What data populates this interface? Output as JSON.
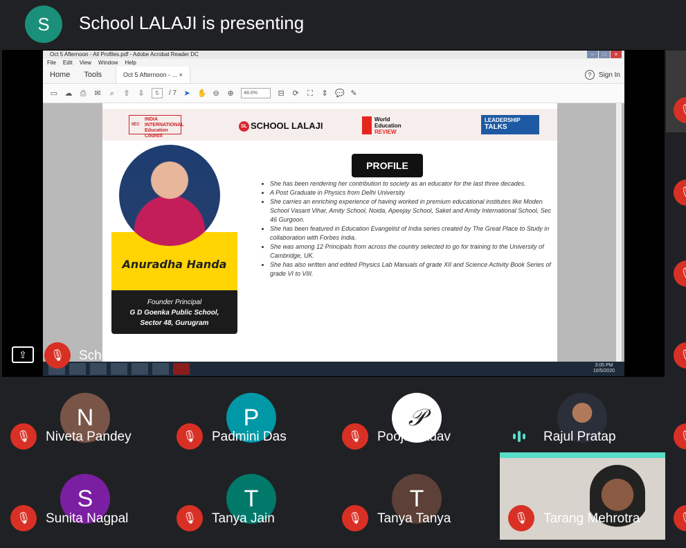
{
  "header": {
    "presenter_initial": "S",
    "title": "School LALAJI is presenting"
  },
  "acrobat": {
    "window_title": "Oct 5 Afternoon - All Profiles.pdf - Adobe Acrobat Reader DC",
    "menu": [
      "File",
      "Edit",
      "View",
      "Window",
      "Help"
    ],
    "tabs": {
      "home": "Home",
      "tools": "Tools",
      "doc": "Oct 5 Afternoon - ...",
      "close": "×"
    },
    "help": "?",
    "sign_in": "Sign In",
    "page_current": "5",
    "page_total": "/ 7",
    "zoom": "48.6%",
    "clock_time": "3:05 PM",
    "clock_date": "10/5/2020"
  },
  "slide": {
    "logos": {
      "iiec": "INDIA INTERNATIONAL Education Council",
      "iiec_badge": "IIEC",
      "school": "SCHOOL LALAJI",
      "school_badge": "SL",
      "wer_line1": "World",
      "wer_line2": "Education",
      "wer_line3": "REVIEW",
      "lt_line1": "LEADERSHIP",
      "lt_line2": "TALKS"
    },
    "speaker_name": "Anuradha Handa",
    "role": "Founder Principal",
    "school_name": "G D Goenka Public School,",
    "school_loc": "Sector 48, Gurugram",
    "profile_heading": "PROFILE",
    "bullets": [
      "She has been rendering her contribution to society as an educator for the last three decades.",
      "A Post Graduate in Physics from Delhi University",
      "She carries an enriching experience of having worked in premium educational institutes like Moden School Vasant Vihar, Amity School, Noida, Apeejay School, Saket and Amity International School, Sec 46 Gurgoon.",
      "She has been featured in Education Evangelist of India series created by The Great Place to Study in collaboration with Forbes India.",
      "She was among 12 Principals from across the country selected to go for training to the University of Cambridge, UK.",
      "She has also written and edited Physics Lab Manuals of grade XII and Science Activity Book Series of grade VI to VIII."
    ]
  },
  "presenter": {
    "name": "School LALAJI"
  },
  "participants": [
    {
      "initial": "N",
      "name": "Niveta Pandey",
      "color": "#795548"
    },
    {
      "initial": "P",
      "name": "Padmini Das",
      "color": "#0097a7"
    },
    {
      "initial": "P",
      "name": "Pooja Yadav",
      "color": "#ffffff"
    },
    {
      "initial": "",
      "name": "Rajul Pratap",
      "color": "#2b2f3a"
    },
    {
      "initial": "S",
      "name": "Sunita Nagpal",
      "color": "#7b1fa2"
    },
    {
      "initial": "T",
      "name": "Tanya Jain",
      "color": "#00796b"
    },
    {
      "initial": "T",
      "name": "Tanya Tanya",
      "color": "#5d4037"
    },
    {
      "initial": "",
      "name": "Tarang Mehrotra",
      "color": "#d8d3cc"
    }
  ],
  "colors": {
    "background": "#202124",
    "mic_off": "#d93025",
    "speaking": "#56dec7"
  }
}
